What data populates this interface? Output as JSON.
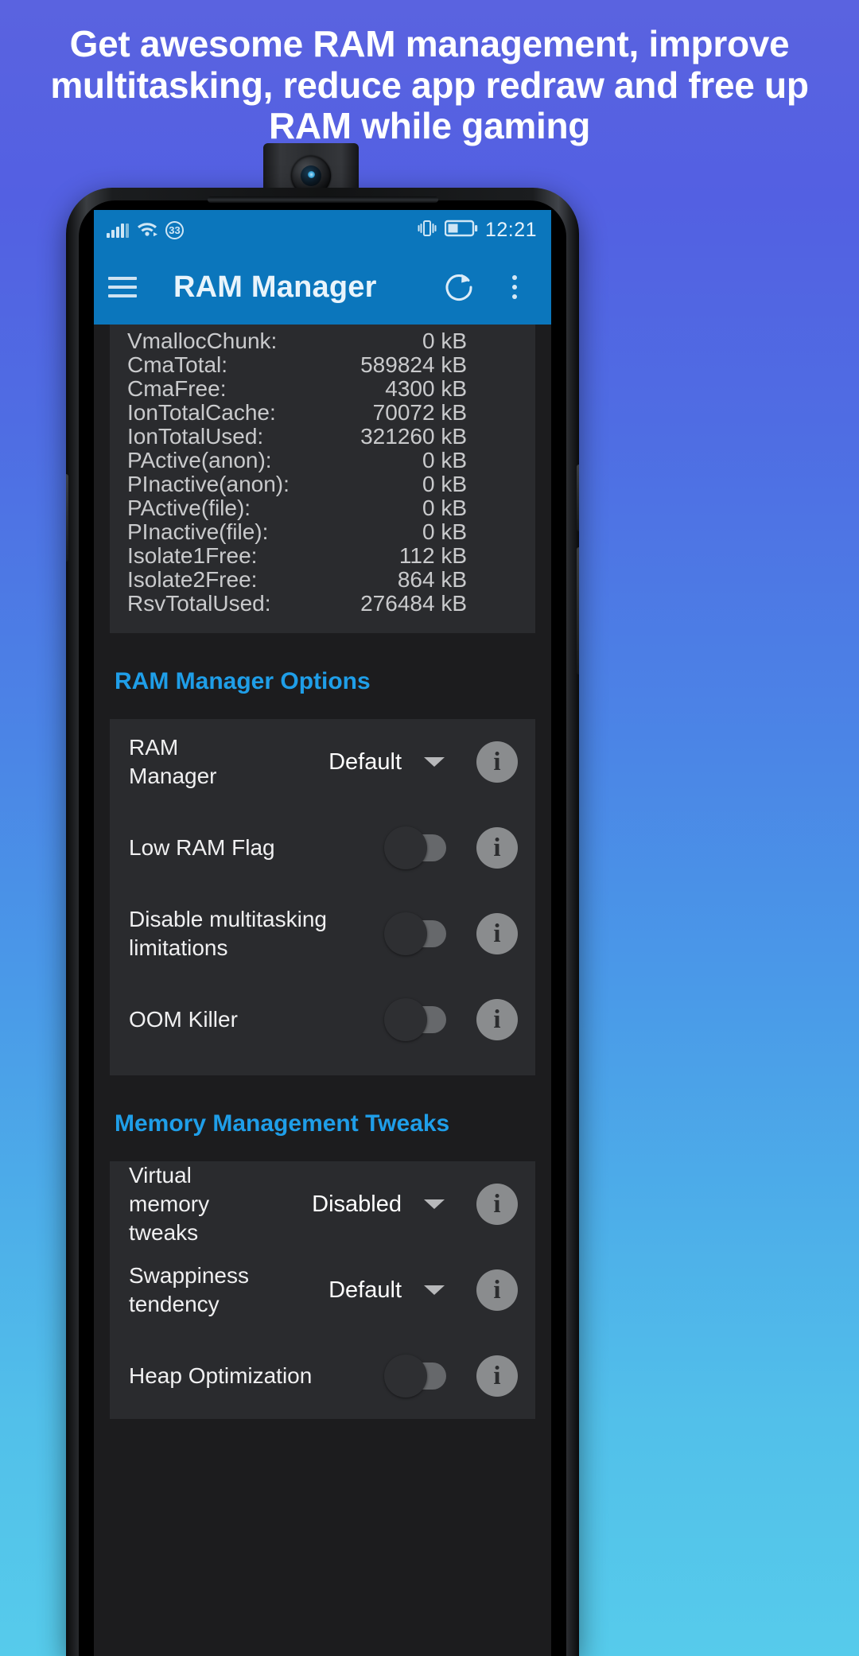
{
  "headline": "Get awesome RAM management, improve multitasking, reduce app redraw and free up RAM while gaming",
  "status_bar": {
    "signal_icon": "cellular-signal-icon",
    "wifi_icon": "wifi-icon",
    "nfc_badge": "33",
    "vibrate_icon": "vibrate-icon",
    "battery_icon": "battery-icon",
    "time": "12:21"
  },
  "app_bar": {
    "menu_icon": "hamburger-menu-icon",
    "title": "RAM Manager",
    "refresh_icon": "refresh-icon",
    "overflow_icon": "more-vertical-icon"
  },
  "meminfo": {
    "rows": [
      {
        "key": "VmallocChunk:",
        "value": "0 kB"
      },
      {
        "key": "CmaTotal:",
        "value": "589824 kB"
      },
      {
        "key": "CmaFree:",
        "value": "4300 kB"
      },
      {
        "key": "IonTotalCache:",
        "value": "70072 kB"
      },
      {
        "key": "IonTotalUsed:",
        "value": "321260 kB"
      },
      {
        "key": "PActive(anon):",
        "value": "0 kB"
      },
      {
        "key": "PInactive(anon):",
        "value": "0 kB"
      },
      {
        "key": "PActive(file):",
        "value": "0 kB"
      },
      {
        "key": "PInactive(file):",
        "value": "0 kB"
      },
      {
        "key": "Isolate1Free:",
        "value": "112 kB"
      },
      {
        "key": "Isolate2Free:",
        "value": "864 kB"
      },
      {
        "key": "RsvTotalUsed:",
        "value": "276484 kB"
      }
    ]
  },
  "sections": [
    {
      "title": "RAM Manager Options",
      "rows": [
        {
          "label": "RAM Manager",
          "control": "dropdown",
          "value": "Default",
          "state": ""
        },
        {
          "label": "Low RAM Flag",
          "control": "switch",
          "value": "",
          "state": "off"
        },
        {
          "label": "Disable multitasking limitations",
          "control": "switch",
          "value": "",
          "state": "off"
        },
        {
          "label": "OOM Killer",
          "control": "switch",
          "value": "",
          "state": "off"
        }
      ]
    },
    {
      "title": "Memory Management Tweaks",
      "rows": [
        {
          "label": "Virtual memory tweaks",
          "control": "dropdown",
          "value": "Disabled",
          "state": ""
        },
        {
          "label": "Swappiness tendency",
          "control": "dropdown",
          "value": "Default",
          "state": ""
        },
        {
          "label": "Heap Optimization",
          "control": "switch",
          "value": "",
          "state": "off"
        }
      ]
    }
  ],
  "colors": {
    "accent_blue": "#1f9ee8",
    "app_bar_blue": "#0b76bc",
    "card_bg": "#2a2b2e",
    "screen_bg": "#1c1c1e",
    "bg_gradient_top": "#5a63e0",
    "bg_gradient_bottom": "#56cbeb"
  }
}
